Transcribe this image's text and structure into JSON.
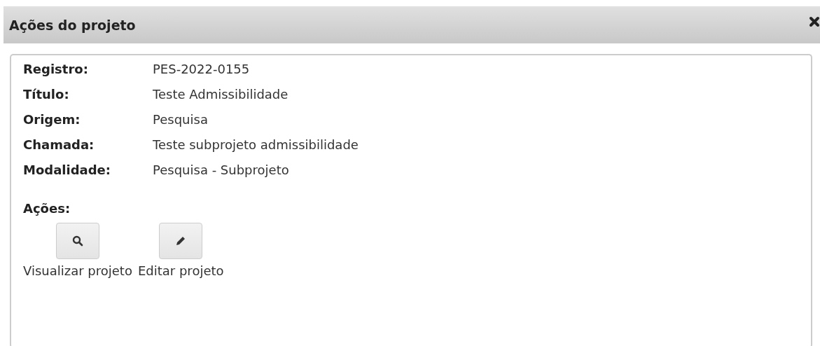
{
  "dialog": {
    "title": "Ações do projeto"
  },
  "fields": [
    {
      "label": "Registro:",
      "value": "PES-2022-0155"
    },
    {
      "label": "Título:",
      "value": "Teste Admissibilidade"
    },
    {
      "label": "Origem:",
      "value": "Pesquisa"
    },
    {
      "label": "Chamada:",
      "value": "Teste subprojeto admissibilidade"
    },
    {
      "label": "Modalidade:",
      "value": "Pesquisa - Subprojeto"
    }
  ],
  "actions": {
    "heading": "Ações:",
    "items": [
      {
        "kind": "view",
        "label": "Visualizar projeto"
      },
      {
        "kind": "edit",
        "label": "Editar projeto"
      }
    ]
  }
}
